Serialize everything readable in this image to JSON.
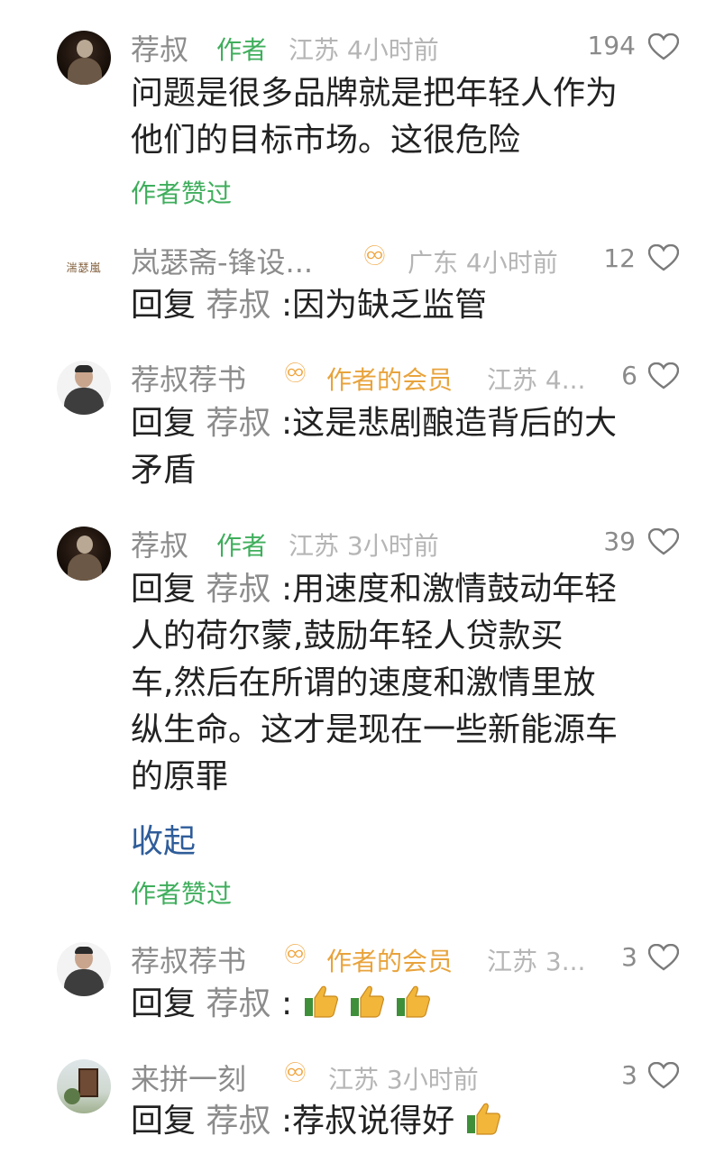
{
  "comments": [
    {
      "name": "荐叔",
      "badge": "作者",
      "meta": "江苏 4小时前",
      "likes": "194",
      "lines": [
        "问题是很多品牌就是把年轻人作为",
        "他们的目标市场。这很危险"
      ],
      "liked_by_author": "作者赞过"
    },
    {
      "name": "岚瑟斋-锋设...",
      "meta": "广东 4小时前",
      "likes": "12",
      "avatar_text": "湍瑟嵐",
      "reply_prefix": "回复",
      "reply_to": "荐叔",
      "content": ":因为缺乏监管"
    },
    {
      "name": "荐叔荐书",
      "badge": "作者的会员",
      "meta": "江苏 4...",
      "likes": "6",
      "reply_prefix": "回复",
      "reply_to": "荐叔",
      "line1": ":这是悲剧酿造背后的大",
      "line2": "矛盾"
    },
    {
      "name": "荐叔",
      "badge": "作者",
      "meta": "江苏 3小时前",
      "likes": "39",
      "reply_prefix": "回复",
      "reply_to": "荐叔",
      "line1": ":用速度和激情鼓动年轻",
      "lines": [
        "人的荷尔蒙,鼓励年轻人贷款买",
        "车,然后在所谓的速度和激情里放",
        "纵生命。这才是现在一些新能源车",
        "的原罪"
      ],
      "collapse": "收起",
      "liked_by_author": "作者赞过"
    },
    {
      "name": "荐叔荐书",
      "badge": "作者的会员",
      "meta": "江苏 3...",
      "likes": "3",
      "reply_prefix": "回复",
      "reply_to": "荐叔",
      "content": ":"
    },
    {
      "name": "来拼一刻",
      "meta": "江苏 3小时前",
      "likes": "3",
      "reply_prefix": "回复",
      "reply_to": "荐叔",
      "content": ":荐叔说得好"
    }
  ],
  "icons": {
    "fan_badge": "fan-badge-icon",
    "heart": "heart-icon",
    "thumb": "thumbs-up-icon"
  },
  "colors": {
    "author_badge": "#3fae5c",
    "member_badge": "#e8a33c",
    "link": "#2f5d9a",
    "meta": "#b5b5b5"
  }
}
